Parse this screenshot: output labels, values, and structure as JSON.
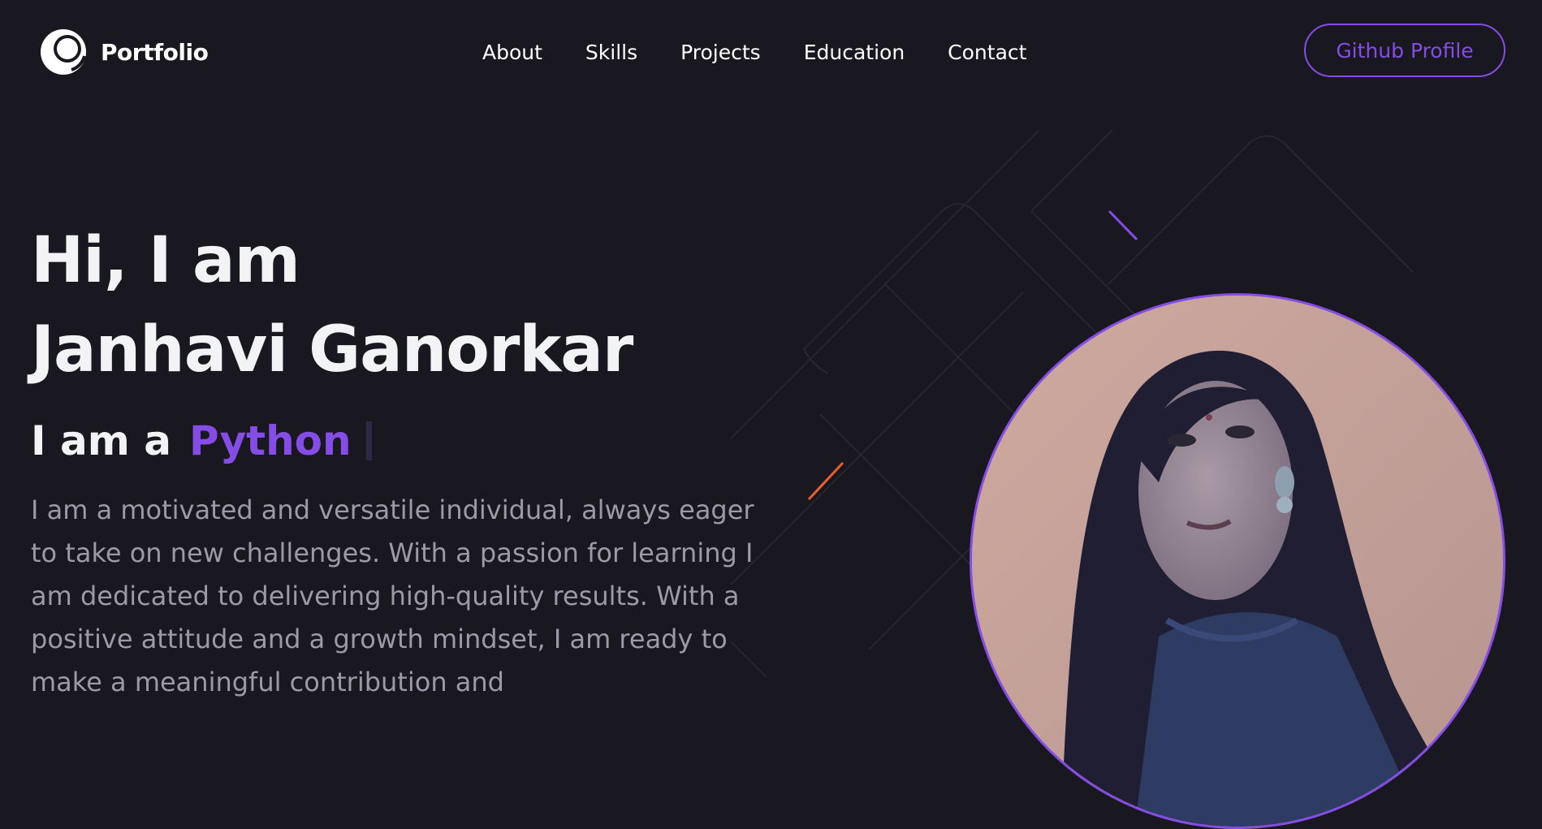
{
  "brand": {
    "name": "Portfolio",
    "logo_icon": "portfolio-logo-icon"
  },
  "nav": {
    "links": [
      {
        "label": "About"
      },
      {
        "label": "Skills"
      },
      {
        "label": "Projects"
      },
      {
        "label": "Education"
      },
      {
        "label": "Contact"
      }
    ],
    "cta_label": "Github Profile"
  },
  "hero": {
    "greeting": "Hi, I am",
    "name": "Janhavi Ganorkar",
    "typing_prefix": "I am a",
    "typing_role": "Python",
    "description": "I am a motivated and versatile individual, always eager to take on new challenges. With a passion for learning I am dedicated to delivering high-quality results. With a positive attitude and a growth mindset, I am ready to make a meaningful contribution and"
  },
  "colors": {
    "background": "#191820",
    "accent": "#854ce6",
    "text_primary": "#f2f3f4",
    "text_secondary": "#9b9aa7"
  }
}
